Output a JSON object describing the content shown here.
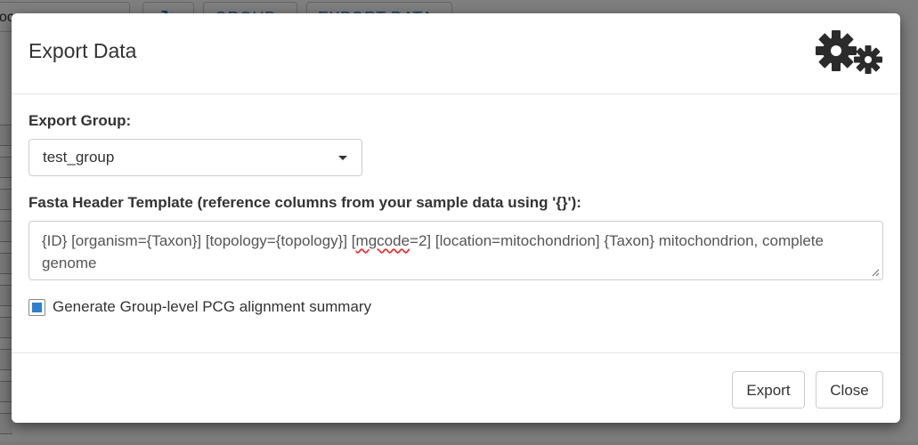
{
  "background": {
    "search_partial": "oc",
    "group_button": "GROUP",
    "export_data_button": "EXPORT DATA"
  },
  "modal": {
    "title": "Export Data",
    "header_icon": "gears-icon",
    "export_group_label": "Export Group:",
    "export_group_selected": "test_group",
    "fasta_template_label": "Fasta Header Template (reference columns from your sample data using '{}'):",
    "fasta_template_parts": {
      "before": "{ID} [organism={Taxon}] [topology={topology}] [",
      "flagged": "mgcode",
      "after": "=2] [location=mitochondrion] {Taxon} mitochondrion, complete genome"
    },
    "checkbox_label": "Generate Group-level PCG alignment summary",
    "checkbox_checked": true,
    "export_button": "Export",
    "close_button": "Close"
  },
  "colors": {
    "accent": "#337ab7",
    "checkbox_fill": "#2f7fd1",
    "spellcheck": "#e03030"
  }
}
